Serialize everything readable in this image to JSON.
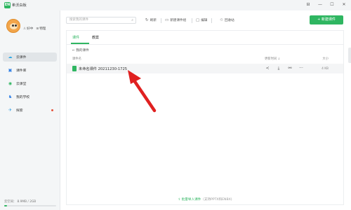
{
  "window": {
    "logo": "EN",
    "title": "希沃白板",
    "buttons": [
      "⊟",
      "—",
      "☐",
      "✕"
    ]
  },
  "sidebar": {
    "user": {
      "name": "好中",
      "org": "物理"
    },
    "items": [
      {
        "label": "云课件",
        "active": true,
        "icon": "cloud-icon",
        "glyph": "☁",
        "color": "#2fa8e5"
      },
      {
        "label": "课件库",
        "active": false,
        "icon": "library-icon",
        "glyph": "▣",
        "color": "#2f7fe5"
      },
      {
        "label": "云课堂",
        "active": false,
        "icon": "classroom-icon",
        "glyph": "◉",
        "color": "#2fb661"
      },
      {
        "label": "我的学校",
        "active": false,
        "icon": "school-icon",
        "glyph": "♞",
        "color": "#2f7fe5"
      },
      {
        "label": "探索",
        "active": false,
        "icon": "explore-icon",
        "glyph": "✈",
        "color": "#2f9fe5",
        "dot": true
      }
    ],
    "storage": {
      "text": "云空间： 8.9MB / 2GB",
      "used_fraction": 0.05
    }
  },
  "toolbar": {
    "search_placeholder": "搜索我的课件",
    "search_icon": "search-icon",
    "refresh": "刷新",
    "new_folder": "新建课件组",
    "edit": "编辑",
    "recycle": "回收站",
    "new_courseware": "+ 新建课件"
  },
  "content": {
    "tabs": [
      "课件",
      "教案"
    ],
    "active_tab": 0,
    "breadcrumb": "← 我的课件",
    "columns": {
      "name": "课件名",
      "updated": "更新时间 ↓",
      "size": "大小"
    },
    "files": [
      {
        "name": "未命名课件 20211230-1725",
        "size": "4 KB"
      }
    ],
    "row_actions": [
      "share-icon",
      "download-icon",
      "link-icon",
      "more-icon"
    ],
    "row_action_glyphs": [
      "≺",
      "⤓",
      "⚯",
      "···"
    ],
    "footer": {
      "label": "批量导入课件",
      "hint": "（支持PPTX和ENBX)"
    }
  },
  "annotation": {
    "arrow_color": "#e02020"
  }
}
